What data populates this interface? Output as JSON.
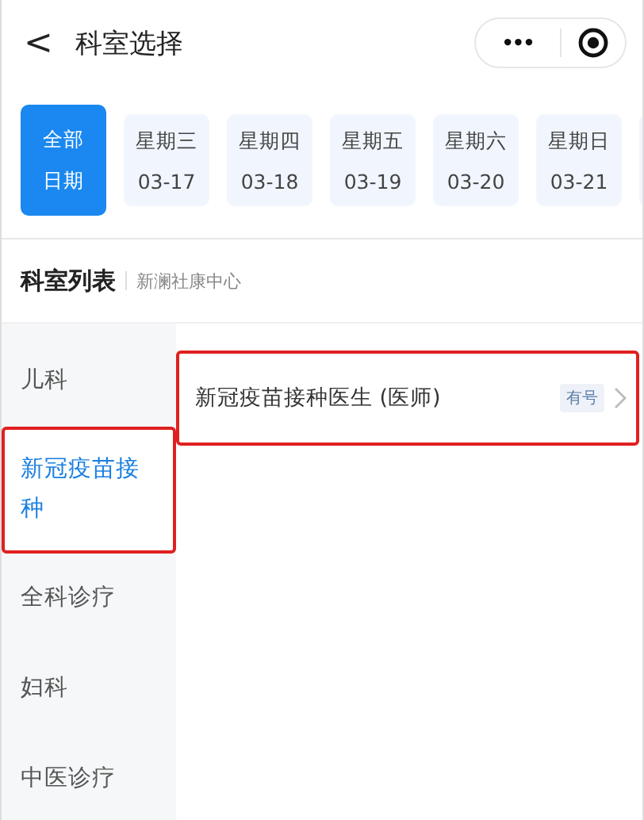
{
  "header": {
    "back": "<",
    "title": "科室选择",
    "more": "•••"
  },
  "dates": [
    {
      "weekday": "全部",
      "date": "日期",
      "selected": true
    },
    {
      "weekday": "星期三",
      "date": "03-17",
      "selected": false
    },
    {
      "weekday": "星期四",
      "date": "03-18",
      "selected": false
    },
    {
      "weekday": "星期五",
      "date": "03-19",
      "selected": false
    },
    {
      "weekday": "星期六",
      "date": "03-20",
      "selected": false
    },
    {
      "weekday": "星期日",
      "date": "03-21",
      "selected": false
    }
  ],
  "section": {
    "title": "科室列表",
    "subtitle": "新澜社康中心"
  },
  "departments": [
    {
      "name": "儿科",
      "selected": false,
      "highlighted": false
    },
    {
      "name": "新冠疫苗接种",
      "selected": true,
      "highlighted": true
    },
    {
      "name": "全科诊疗",
      "selected": false,
      "highlighted": false
    },
    {
      "name": "妇科",
      "selected": false,
      "highlighted": false
    },
    {
      "name": "中医诊疗",
      "selected": false,
      "highlighted": false
    }
  ],
  "doctors": [
    {
      "name": "新冠疫苗接种医生 (医师)",
      "tag": "有号",
      "highlighted": true
    }
  ]
}
